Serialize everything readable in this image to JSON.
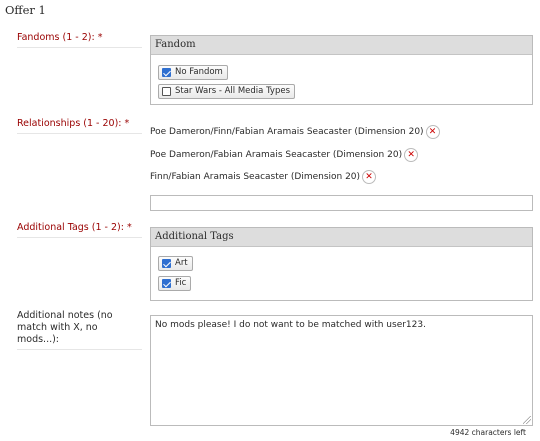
{
  "offer": {
    "heading": "Offer 1"
  },
  "fandoms": {
    "label": "Fandoms (1 - 2): *",
    "box_title": "Fandom",
    "options": [
      {
        "label": "No Fandom",
        "checked": true
      },
      {
        "label": "Star Wars - All Media Types",
        "checked": false
      }
    ]
  },
  "relationships": {
    "label": "Relationships (1 - 20): *",
    "tags": [
      "Poe Dameron/Finn/Fabian Aramais Seacaster (Dimension 20)",
      "Poe Dameron/Fabian Aramais Seacaster (Dimension 20)",
      "Finn/Fabian Aramais Seacaster (Dimension 20)"
    ],
    "remove_glyph": "✕",
    "input_value": ""
  },
  "additional_tags": {
    "label": "Additional Tags (1 - 2): *",
    "box_title": "Additional Tags",
    "options": [
      {
        "label": "Art",
        "checked": true
      },
      {
        "label": "Fic",
        "checked": true
      }
    ]
  },
  "notes": {
    "label": "Additional notes (no match with X, no mods...):",
    "value": "No mods please! I do not want to be matched with user123.",
    "chars_left": "4942 characters left"
  },
  "colors": {
    "required_label": "#990000",
    "remove_icon": "#cc0000",
    "checkbox": "#2f6fd0"
  }
}
